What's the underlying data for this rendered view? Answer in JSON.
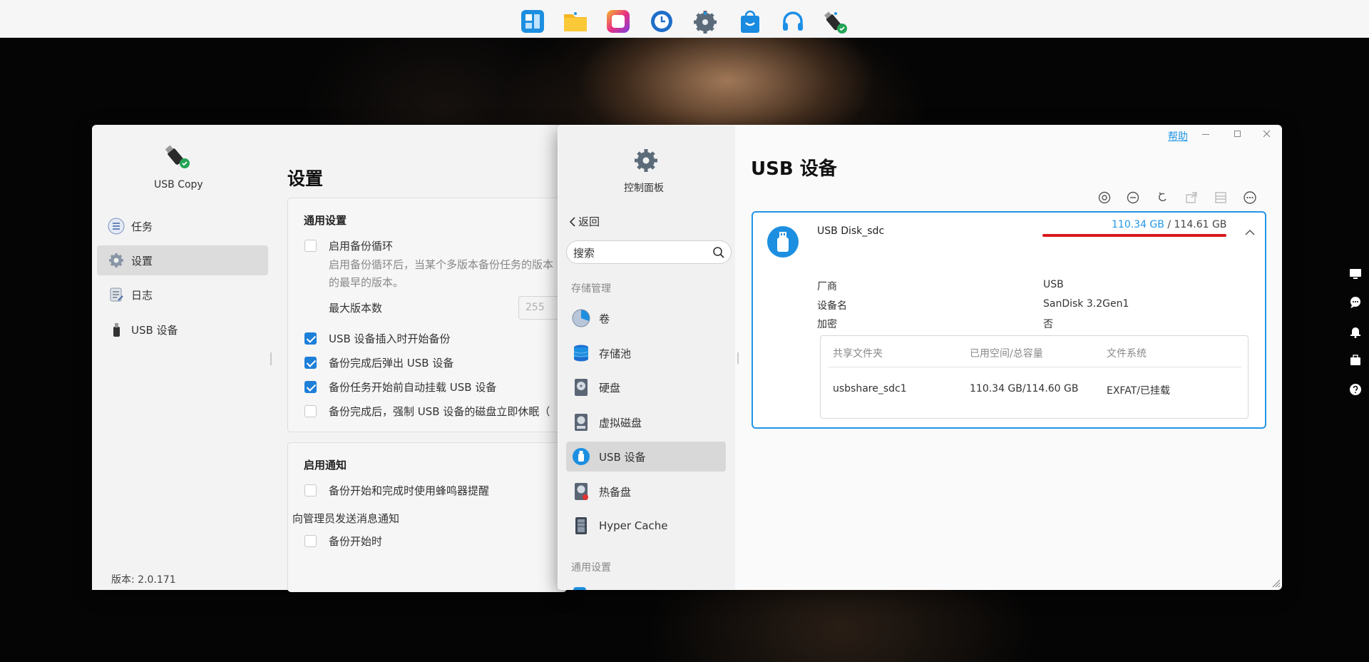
{
  "dock": {
    "apps": [
      {
        "icon": "grid-app-icon",
        "color": "#1d8fe0"
      },
      {
        "icon": "folder-icon",
        "color": "#f4b521"
      },
      {
        "icon": "photos-app-icon",
        "color": "#e23c8a"
      },
      {
        "icon": "clock-app-icon",
        "color": "#1f6fc9"
      },
      {
        "icon": "gear-app-icon",
        "color": "#5c6b7a"
      },
      {
        "icon": "app-store-icon",
        "color": "#1a8be0"
      },
      {
        "icon": "headset-icon",
        "color": "#1b8fe6"
      },
      {
        "icon": "usb-copy-app-icon",
        "color": "#2b2b2b"
      }
    ]
  },
  "usb_copy": {
    "app_name": "USB Copy",
    "nav": [
      "任务",
      "设置",
      "日志",
      "USB 设备"
    ],
    "page_title": "设置",
    "general": {
      "title": "通用设置",
      "enable_cycle": "启用备份循环",
      "desc_line1": "启用备份循环后，当某个多版本备份任务的版本",
      "desc_line2": "的最早的版本。",
      "max_versions_label": "最大版本数",
      "max_versions_value": "255",
      "opt_start_on_insert": "USB 设备插入时开始备份",
      "opt_eject_after": "备份完成后弹出 USB 设备",
      "opt_auto_mount": "备份任务开始前自动挂载 USB 设备",
      "opt_sleep_after": "备份完成后，强制 USB 设备的磁盘立即休眠（"
    },
    "notify": {
      "title": "启用通知",
      "buzzer": "备份开始和完成时使用蜂鸣器提醒",
      "admin_label": "向管理员发送消息通知",
      "on_start": "备份开始时"
    },
    "version": "版本: 2.0.171"
  },
  "control_panel": {
    "app_name": "控制面板",
    "help": "帮助",
    "back": "返回",
    "search_placeholder": "搜索",
    "section_storage": "存储管理",
    "items": [
      "卷",
      "存储池",
      "硬盘",
      "虚拟磁盘",
      "USB 设备",
      "热备盘",
      "Hyper Cache"
    ],
    "section_general": "通用设置",
    "page_title": "USB 设备",
    "device": {
      "name": "USB Disk_sdc",
      "used": "110.34 GB",
      "separator": " / ",
      "total": "114.61 GB",
      "vendor_label": "厂商",
      "vendor_value": "USB",
      "devname_label": "设备名",
      "devname_value": "SanDisk 3.2Gen1",
      "encrypt_label": "加密",
      "encrypt_value": "否",
      "table": {
        "headers": [
          "共享文件夹",
          "已用空间/总容量",
          "文件系统"
        ],
        "rows": [
          [
            "usbshare_sdc1",
            "110.34 GB/114.60 GB",
            "EXFAT/已挂载"
          ]
        ]
      }
    },
    "colors": {
      "accent": "#2196e6",
      "annotation": "#d8181d"
    }
  }
}
